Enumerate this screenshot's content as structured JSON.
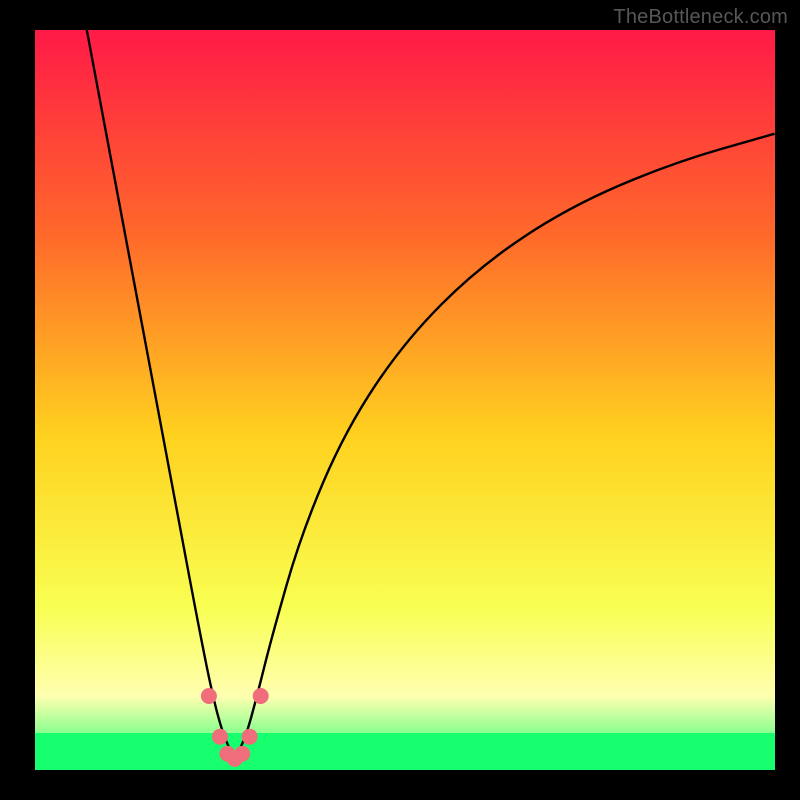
{
  "watermark": "TheBottleneck.com",
  "colors": {
    "background": "#000000",
    "gradient_top": "#ff1a47",
    "gradient_mid1": "#ff6a2a",
    "gradient_mid2": "#ffd21f",
    "gradient_mid3": "#f8ff52",
    "gradient_mid4": "#ffffb0",
    "gradient_bottom": "#17ff6e",
    "curve": "#000000",
    "marker_fill": "#f06d7b",
    "marker_stroke": "#f06d7b"
  },
  "chart_data": {
    "type": "line",
    "title": "",
    "xlabel": "",
    "ylabel": "",
    "xlim": [
      0,
      100
    ],
    "ylim": [
      0,
      100
    ],
    "x_min_at": 27,
    "series": [
      {
        "name": "bottleneck-curve",
        "x": [
          7,
          10,
          13,
          16,
          19,
          22,
          24,
          25.5,
          27,
          28.5,
          30,
          32,
          36,
          42,
          50,
          60,
          72,
          86,
          100
        ],
        "y": [
          100,
          84,
          68,
          52,
          36,
          20,
          10,
          4.5,
          1.5,
          4.5,
          10,
          18,
          32,
          46,
          58,
          68,
          76,
          82,
          86
        ]
      }
    ],
    "markers": {
      "name": "highlight-points",
      "x": [
        23.5,
        25.0,
        26.0,
        27.0,
        28.0,
        29.0,
        30.5
      ],
      "y": [
        10.0,
        4.5,
        2.2,
        1.5,
        2.2,
        4.5,
        10.0
      ]
    },
    "green_band": {
      "y_from": 0,
      "y_to": 5
    }
  }
}
